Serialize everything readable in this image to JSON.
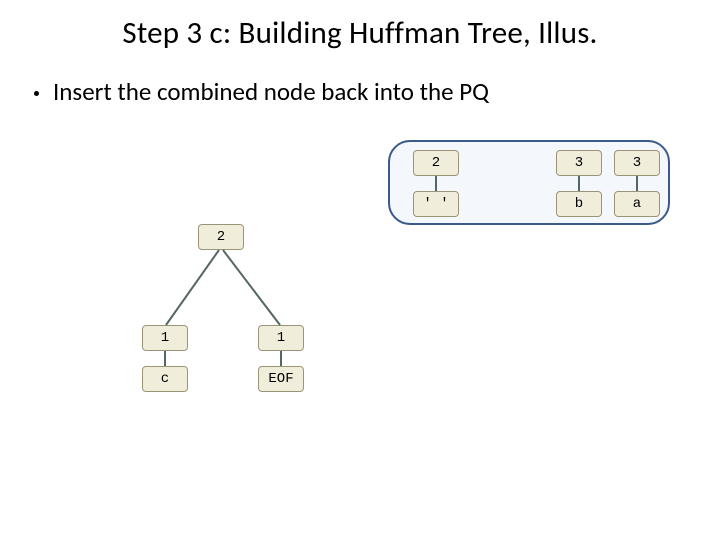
{
  "slide": {
    "title": "Step 3 c: Building Huffman Tree, Illus.",
    "bullet": "Insert the combined node back into the PQ"
  },
  "pq": {
    "items": [
      {
        "freq": "2",
        "label": "' '"
      },
      {
        "freq": "3",
        "label": "b"
      },
      {
        "freq": "3",
        "label": "a"
      }
    ]
  },
  "tree": {
    "root_freq": "2",
    "left": {
      "freq": "1",
      "label": "c"
    },
    "right": {
      "freq": "1",
      "label": "EOF"
    }
  }
}
